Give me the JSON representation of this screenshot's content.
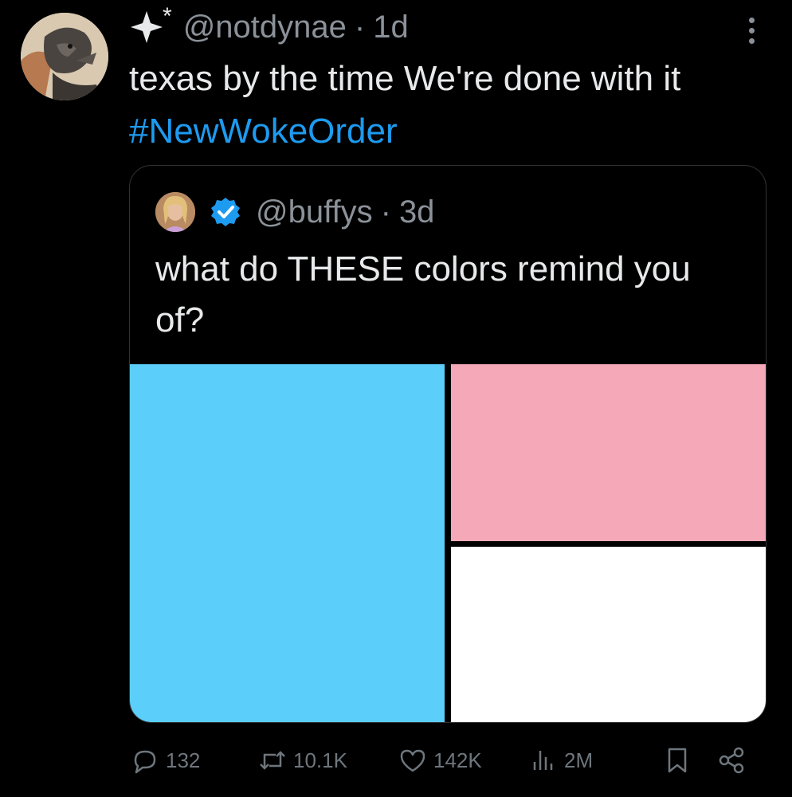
{
  "tweet": {
    "handle": "@notdynae",
    "time": "1d",
    "dot": "·",
    "asterisk": "*",
    "text_before": "texas  by the time We're done with it ",
    "hashtag": "#NewWokeOrder"
  },
  "quote": {
    "handle": "@buffys",
    "time": "3d",
    "dot": "·",
    "text": "what do THESE colors remind you of?",
    "tiles": [
      {
        "name": "blue",
        "color": "#5bcefa"
      },
      {
        "name": "pink",
        "color": "#f5a9b8"
      },
      {
        "name": "white",
        "color": "#ffffff"
      }
    ]
  },
  "actions": {
    "replies": "132",
    "retweets": "10.1K",
    "likes": "142K",
    "views": "2M"
  },
  "icons": [
    "sparkle-icon",
    "more-icon",
    "verified-icon",
    "reply-icon",
    "retweet-icon",
    "like-icon",
    "views-icon",
    "bookmark-icon",
    "share-icon"
  ],
  "colors": {
    "background": "#000000",
    "text": "#e7e9ea",
    "muted": "#8b9198",
    "link": "#1d9bf0",
    "verified": "#1d9bf0"
  }
}
